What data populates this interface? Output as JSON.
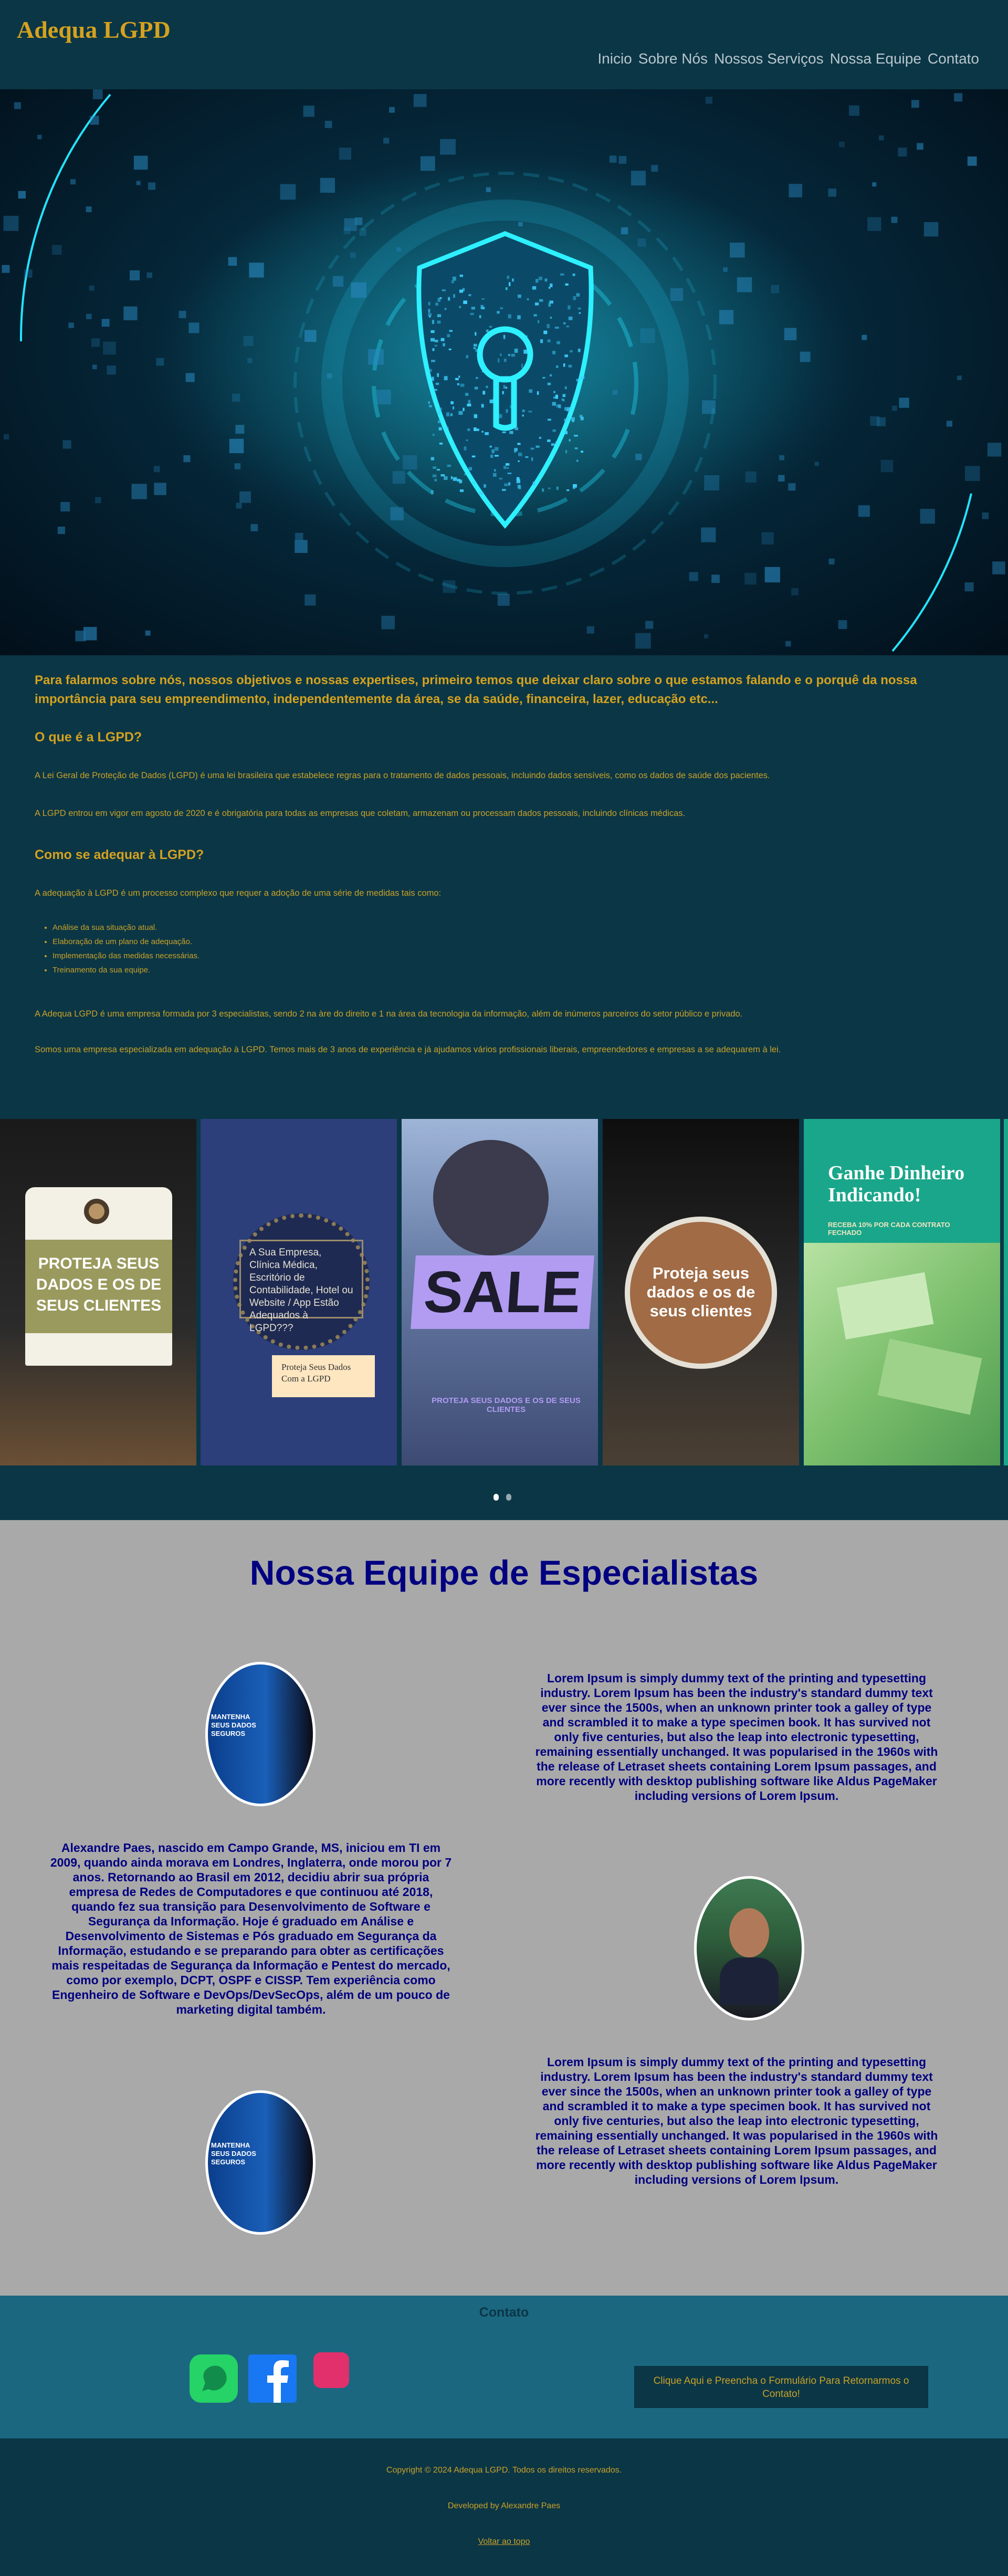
{
  "brand": "Adequa LGPD",
  "nav": [
    "Inicio",
    "Sobre Nós",
    "Nossos Serviços",
    "Nossa Equipe",
    "Contato"
  ],
  "intro": {
    "lead": "Para falarmos sobre nós, nossos objetivos e nossas expertises, primeiro temos que deixar claro sobre o que estamos falando e o porquê da nossa importância para seu empreendimento, independentemente da área, se da saúde, financeira, lazer, educação etc...",
    "h_what": "O que é a LGPD?",
    "p_what_1": "A Lei Geral de Proteção de Dados (LGPD) é uma lei brasileira que estabelece regras para o tratamento de dados pessoais, incluindo dados sensíveis, como os dados de saúde dos pacientes.",
    "p_what_2": "A LGPD entrou em vigor em agosto de 2020 e é obrigatória para todas as empresas que coletam, armazenam ou processam dados pessoais, incluindo clínicas médicas.",
    "h_how": "Como se adequar à LGPD?",
    "p_how": "A adequação à LGPD é um processo complexo que requer a adoção de uma série de medidas tais como:",
    "steps": [
      "Análise da sua situação atual.",
      "Elaboração de um plano de adequação.",
      "Implementação das medidas necessárias.",
      "Treinamento da sua equipe."
    ],
    "p_about_1": "A Adequa LGPD é uma empresa formada por 3 especialistas, sendo 2 na àre do direito e 1 na área da tecnologia da informação, além de inúmeros parceiros do setor público e privado.",
    "p_about_2": "Somos uma empresa especializada em adequação à LGPD. Temos mais de 3 anos de experiência e já ajudamos vários profissionais liberais, empreendedores e empresas a se adequarem à lei."
  },
  "carousel": {
    "slide1": {
      "tag": "PROTEJA SEUS DADOS E OS DE SEUS CLIENTES"
    },
    "slide2": {
      "text": "A Sua Empresa, Clínica Médica, Escritório de Contabilidade, Hotel ou Website / App Estão Adequados à LGPD???",
      "note": "Proteja Seus Dados Com a LGPD"
    },
    "slide3": {
      "big": "SALE",
      "small": "PROTEJA SEUS DADOS E OS DE SEUS CLIENTES"
    },
    "slide4": {
      "text": "Proteja seus dados e os de seus clientes"
    },
    "slide5": {
      "title": "Ganhe Dinheiro Indicando!",
      "sub": "RECEBA 10% POR CADA CONTRATO FECHADO"
    },
    "active_slide": 1,
    "slide_count": 2
  },
  "team": {
    "title": "Nossa Equipe de Especialistas",
    "badge_text": "MANTENHA SEUS DADOS SEGUROS",
    "lorem_1": "Lorem Ipsum is simply dummy text of the printing and typesetting industry. Lorem Ipsum has been the industry's standard dummy text ever since the 1500s, when an unknown printer took a galley of type and scrambled it to make a type specimen book. It has survived not only five centuries, but also the leap into electronic typesetting, remaining essentially unchanged. It was popularised in the 1960s with the release of Letraset sheets containing Lorem Ipsum passages, and more recently with desktop publishing software like Aldus PageMaker including versions of Lorem Ipsum.",
    "bio": "Alexandre Paes, nascido em Campo Grande, MS, iniciou em TI em 2009, quando ainda morava em Londres, Inglaterra, onde morou por 7 anos. Retornando ao Brasil em 2012, decidiu abrir sua própria empresa de Redes de Computadores e que continuou até 2018, quando fez sua transição para Desenvolvimento de Software e Segurança da Informação. Hoje é graduado em Análise e Desenvolvimento de Sistemas e Pós graduado em Segurança da Informação, estudando e se preparando para obter as certificações mais respeitadas de Segurança da Informação e Pentest do mercado, como por exemplo, DCPT, OSPF e CISSP. Tem experiência como Engenheiro de Software e DevOps/DevSecOps, além de um pouco de marketing digital também.",
    "lorem_2": "Lorem Ipsum is simply dummy text of the printing and typesetting industry. Lorem Ipsum has been the industry's standard dummy text ever since the 1500s, when an unknown printer took a galley of type and scrambled it to make a type specimen book. It has survived not only five centuries, but also the leap into electronic typesetting, remaining essentially unchanged. It was popularised in the 1960s with the release of Letraset sheets containing Lorem Ipsum passages, and more recently with desktop publishing software like Aldus PageMaker including versions of Lorem Ipsum."
  },
  "contact": {
    "title": "Contato",
    "icons": [
      "whatsapp-icon",
      "facebook-icon",
      "instagram-icon"
    ],
    "button": "Clique Aqui e Preencha o Formulário Para Retornarmos o Contato!"
  },
  "footer": {
    "copyright": "Copyright © 2024 Adequa LGPD. Todos os direitos reservados.",
    "developer": "Developed by Alexandre Paes",
    "back_top": "Voltar ao topo"
  },
  "colors": {
    "accent": "#d4a21f",
    "bg": "#0b3646",
    "team_bg": "#a9a9a9",
    "team_text": "#000080",
    "contact_bg": "#1b6780"
  }
}
